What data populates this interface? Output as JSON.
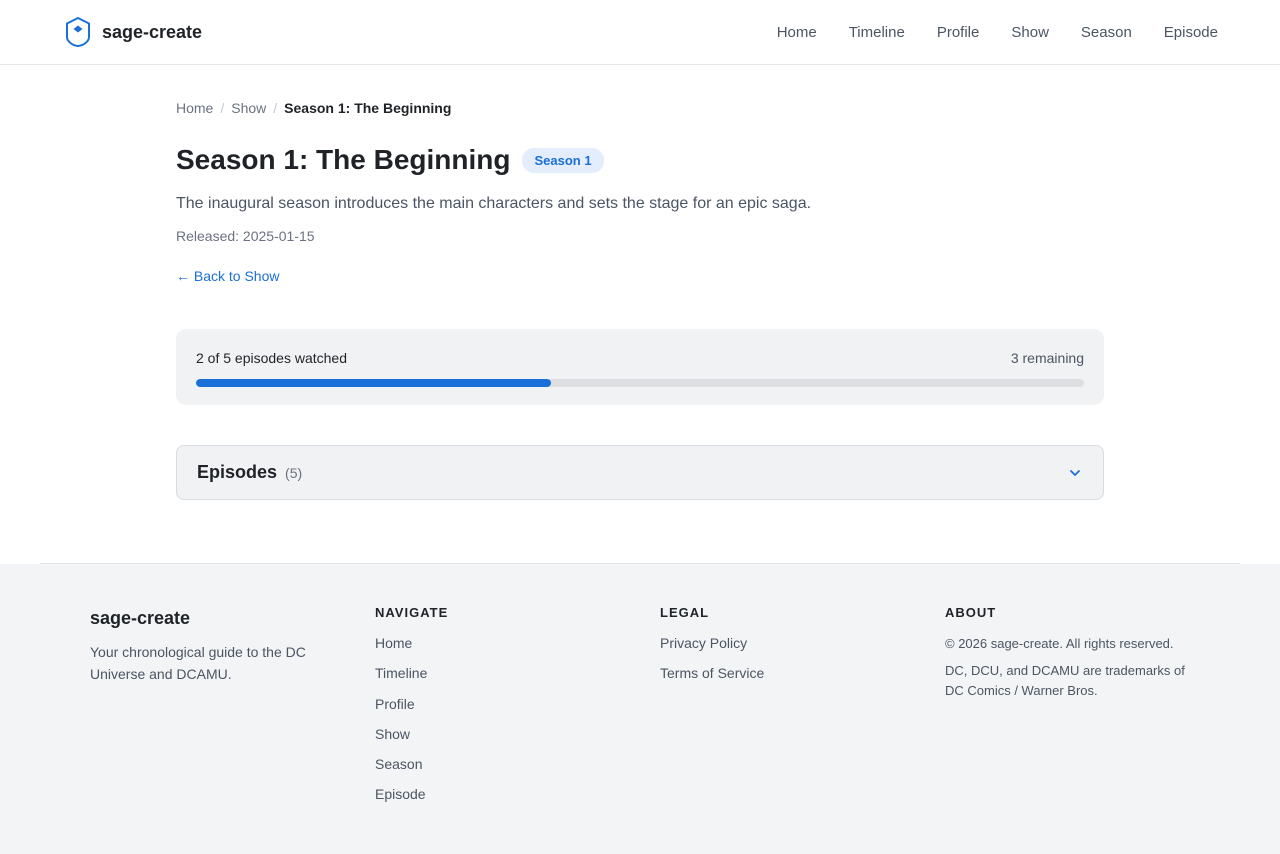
{
  "brand": {
    "name": "sage-create",
    "icon": "shield-icon"
  },
  "nav": {
    "items": [
      "Home",
      "Timeline",
      "Profile",
      "Show",
      "Season",
      "Episode"
    ]
  },
  "breadcrumb": {
    "items": [
      "Home",
      "Show"
    ],
    "current": "Season 1: The Beginning"
  },
  "season": {
    "title": "Season 1: The Beginning",
    "badge": "Season 1",
    "description": "The inaugural season introduces the main characters and sets the stage for an epic saga.",
    "released": "Released: 2025-01-15",
    "back_link": "← Back to Show"
  },
  "progress": {
    "watched_text": "2 of 5 episodes watched",
    "remaining_text": "3 remaining",
    "watched": 2,
    "total": 5
  },
  "episodes": {
    "title": "Episodes",
    "count": "(5)",
    "icon": "chevron-down-icon"
  },
  "footer": {
    "brand": "sage-create",
    "tagline": "Your chronological guide to the DC Universe and DCAMU.",
    "navigate": {
      "title": "NAVIGATE",
      "items": [
        "Home",
        "Timeline",
        "Profile",
        "Show",
        "Season",
        "Episode"
      ]
    },
    "legal": {
      "title": "LEGAL",
      "items": [
        "Privacy Policy",
        "Terms of Service"
      ]
    },
    "about": {
      "title": "ABOUT",
      "copyright": "© 2026 sage-create. All rights reserved.",
      "trademark": "DC, DCU, and DCAMU are trademarks of DC Comics / Warner Bros."
    }
  },
  "colors": {
    "accent": "#1a6fd8",
    "badge_bg": "#e3edfb",
    "card_bg": "#f1f2f4",
    "footer_bg": "#f3f4f6"
  }
}
